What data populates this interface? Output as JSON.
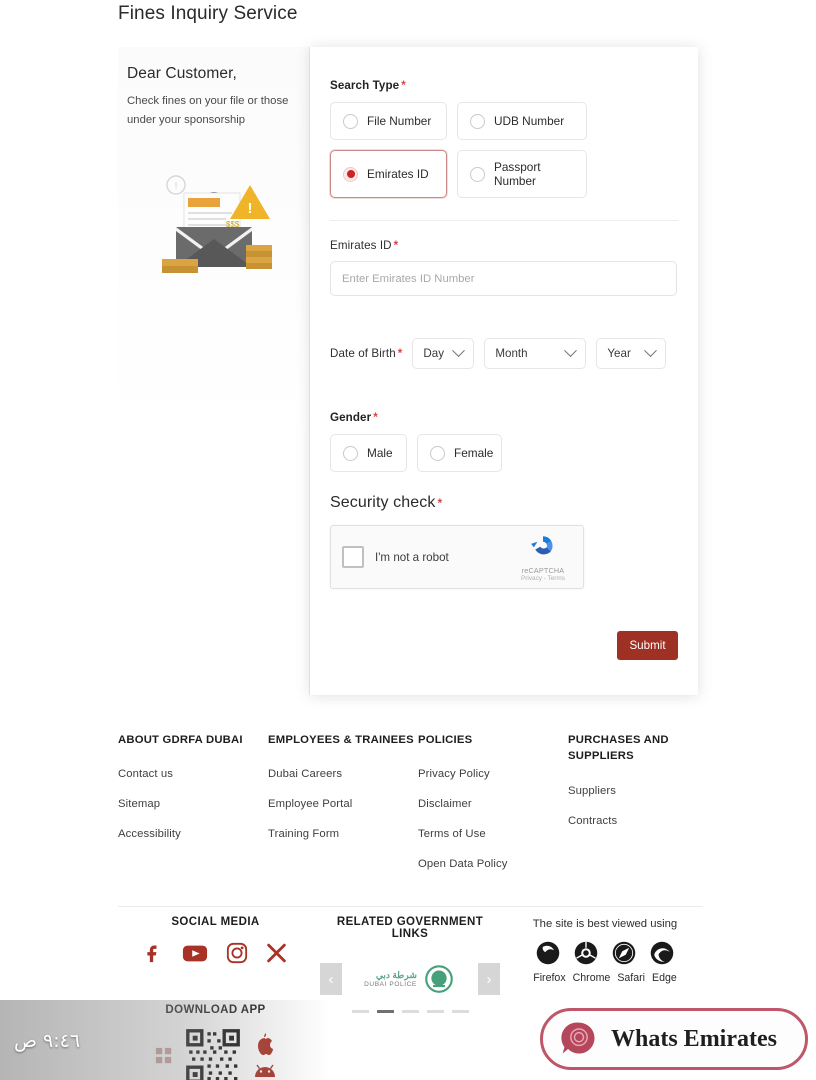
{
  "page": {
    "title": "Fines Inquiry Service"
  },
  "intro": {
    "heading": "Dear Customer,",
    "body": "Check fines on your file or those under your sponsorship"
  },
  "form": {
    "search_type": {
      "label": "Search Type",
      "required_mark": "*",
      "options": [
        {
          "label": "File Number",
          "selected": false
        },
        {
          "label": "UDB Number",
          "selected": false
        },
        {
          "label": "Emirates ID",
          "selected": true
        },
        {
          "label": "Passport Number",
          "selected": false
        }
      ]
    },
    "emirates_id": {
      "label": "Emirates ID",
      "required_mark": "*",
      "placeholder": "Enter Emirates ID Number",
      "value": ""
    },
    "date_of_birth": {
      "label": "Date of Birth",
      "required_mark": "*",
      "day": "Day",
      "month": "Month",
      "year": "Year"
    },
    "gender": {
      "label": "Gender",
      "required_mark": "*",
      "options": [
        {
          "label": "Male",
          "selected": false
        },
        {
          "label": "Female",
          "selected": false
        }
      ]
    },
    "security": {
      "label": "Security check",
      "required_mark": "*",
      "recaptcha_label": "I'm not a robot",
      "recaptcha_brand": "reCAPTCHA",
      "recaptcha_legal": "Privacy - Terms"
    },
    "submit_label": "Submit"
  },
  "footer": {
    "columns": [
      {
        "heading": "ABOUT GDRFA DUBAI",
        "links": [
          "Contact us",
          "Sitemap",
          "Accessibility"
        ]
      },
      {
        "heading": "EMPLOYEES & TRAINEES",
        "links": [
          "Dubai Careers",
          "Employee Portal",
          "Training Form"
        ]
      },
      {
        "heading": "POLICIES",
        "links": [
          "Privacy Policy",
          "Disclaimer",
          "Terms of Use",
          "Open Data Policy"
        ]
      },
      {
        "heading": "PURCHASES AND SUPPLIERS",
        "links": [
          "Suppliers",
          "Contracts"
        ]
      }
    ],
    "social": {
      "title": "SOCIAL MEDIA",
      "icons": [
        "facebook-icon",
        "youtube-icon",
        "instagram-icon",
        "x-twitter-icon"
      ]
    },
    "download": {
      "title": "DOWNLOAD APP",
      "icons": [
        "qr-code",
        "apple-icon",
        "android-icon"
      ]
    },
    "government": {
      "title": "RELATED GOVERNMENT LINKS",
      "logo_text_ar": "شرطة دبي",
      "logo_text_en": "DUBAI POLICE",
      "prev_label": "‹",
      "next_label": "›",
      "dots": 5,
      "active_dot": 2
    },
    "browsers": {
      "title": "The site is best viewed using",
      "names": [
        "Firefox",
        "Chrome",
        "Safari",
        "Edge"
      ]
    }
  },
  "overlay": {
    "time": "٩:٤٦ ص",
    "watermark_text": "Whats Emirates"
  },
  "colors": {
    "accent_red": "#9e3024",
    "radio_red": "#cf2222",
    "social_red": "#a93226",
    "watermark_border": "#c0566a"
  }
}
